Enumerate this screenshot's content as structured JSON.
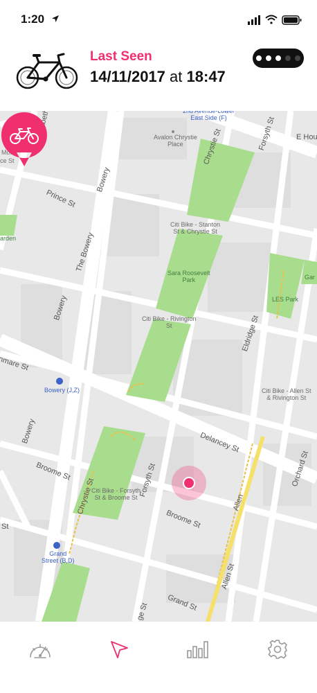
{
  "status_bar": {
    "time": "1:20"
  },
  "header": {
    "last_seen_label": "Last Seen",
    "date": "14/11/2017",
    "at_word": "at",
    "time": "18:47",
    "battery_level_of_5": 3,
    "accent_color": "#ef2f6e"
  },
  "map": {
    "streets": {
      "elizabeth": "Elizabeth St",
      "bowery_top": "Bowery",
      "prince": "Prince St",
      "the_bowery": "The Bowery",
      "bowery_mid": "Bowery",
      "bowery_bottom": "Bowery",
      "chrystie_top": "Chrystie St",
      "chrystie_bottom": "Chrystie St",
      "forsyth_top": "Forsyth St",
      "forsyth_bottom": "Forsyth St",
      "eldridge": "Eldridge St",
      "delancey": "Delancey St",
      "broome_left": "Broome St",
      "broome_right": "Broome St",
      "grand": "Grand St",
      "allen": "Allen St",
      "allen_top": "Allen",
      "orchard": "Orchard St",
      "e_houston": "E Hous",
      "kenmare": "nmare St",
      "mott": "Mott",
      "ce_st": "ce St",
      "ge_st": "ge St",
      "st_left": "St"
    },
    "pois": {
      "avenue_lower_east_side": "2nd Avenue-Lower\nEast Side (F)",
      "avalon": "Avalon Chrystie\nPlace",
      "citi_stanton": "Citi Bike - Stanton\nSt & Chrystie St",
      "sara_roosevelt": "Sara Roosevelt\nPark",
      "citi_rivington": "Citi Bike - Rivington\nSt",
      "les_park": "LES Park",
      "citi_allen": "Citi Bike - Allen St\n& Rivington St",
      "bowery_station": "Bowery (J,Z)",
      "citi_forsyth": "Citi Bike - Forsyth\nSt & Broome St",
      "grand_street_station": "Grand\nStreet (B,D)",
      "garden": "arden",
      "gar": "Gar"
    }
  },
  "tabs": [
    {
      "name": "speedometer-icon",
      "active": false
    },
    {
      "name": "navigation-arrow-icon",
      "active": true
    },
    {
      "name": "stats-bars-icon",
      "active": false
    },
    {
      "name": "settings-gear-icon",
      "active": false
    }
  ]
}
